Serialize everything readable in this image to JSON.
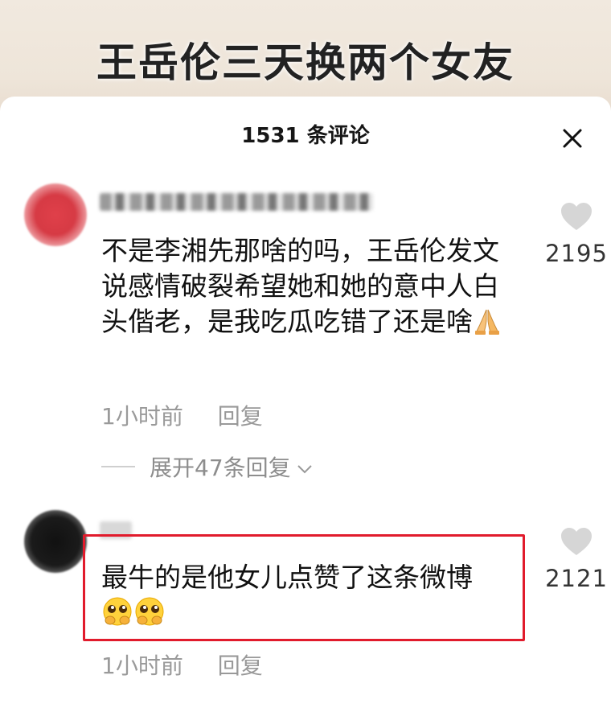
{
  "video": {
    "title": "王岳伦三天换两个女友"
  },
  "comments_panel": {
    "header": "1531 条评论",
    "close_icon": "close-icon"
  },
  "comments": [
    {
      "text": "不是李湘先那啥的吗，王岳伦发文说感情破裂希望她和她的意中人白头偕老，是我吃瓜吃错了还是啥",
      "emoji": [
        "folded-hands-emoji"
      ],
      "time": "1小时前",
      "reply_label": "回复",
      "likes": "2195",
      "expand_label": "展开47条回复"
    },
    {
      "text": "最牛的是他女儿点赞了这条微博",
      "emoji": [
        "pleading-face-emoji",
        "pleading-face-emoji"
      ],
      "time": "1小时前",
      "reply_label": "回复",
      "likes": "2121"
    }
  ],
  "colors": {
    "highlight": "#e11b2c",
    "like_icon": "#d6d6d6",
    "muted_text": "#9a9a9a"
  }
}
